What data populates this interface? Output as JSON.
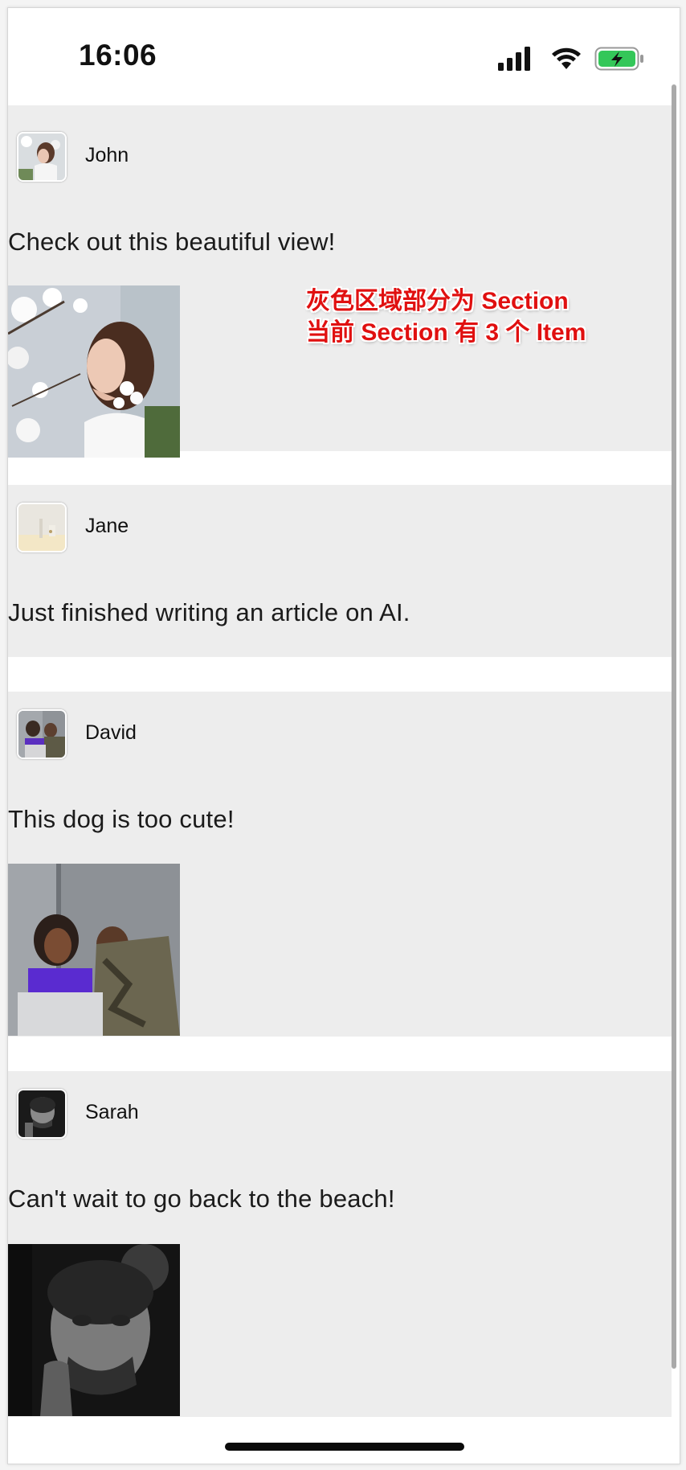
{
  "status_bar": {
    "time": "16:06",
    "icons": [
      "cellular-signal-icon",
      "wifi-icon",
      "battery-charging-icon"
    ],
    "battery_color": "#34c759"
  },
  "annotation": {
    "line1": "灰色区域部分为 Section",
    "line2": "当前 Section 有 3 个 Item",
    "color": "#e01010"
  },
  "feed": {
    "section_background": "#ededed",
    "posts": [
      {
        "user": "John",
        "text": "Check out this beautiful view!",
        "has_image": true,
        "image": "woman-with-blossoms-photo"
      },
      {
        "user": "Jane",
        "text": "Just finished writing an article on AI.",
        "has_image": false
      },
      {
        "user": "David",
        "text": "This dog is too cute!",
        "has_image": true,
        "image": "couple-with-laptop-photo"
      },
      {
        "user": "Sarah",
        "text": "Can't wait to go back to the beach!",
        "has_image": true,
        "image": "man-black-and-white-photo"
      }
    ]
  }
}
